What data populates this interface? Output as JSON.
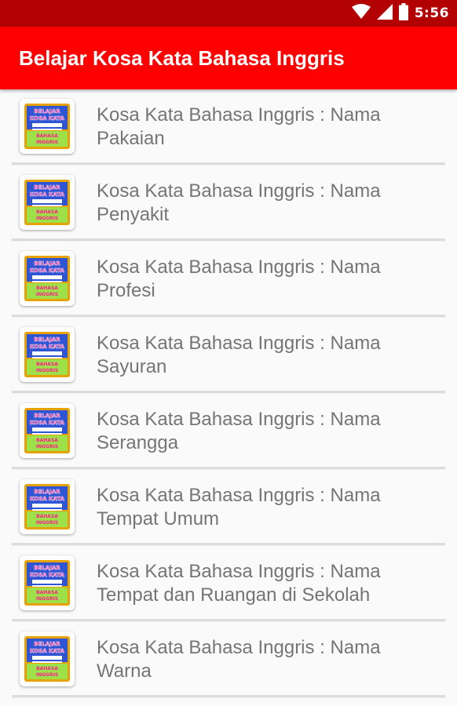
{
  "status_bar": {
    "time": "5:56",
    "icons": [
      "wifi-icon",
      "signal-icon",
      "battery-icon"
    ],
    "color": "#b30000"
  },
  "app_bar": {
    "title": "Belajar Kosa Kata Bahasa Inggris",
    "color": "#ff0000"
  },
  "app_icon": {
    "line1": "BELAJAR",
    "line2": "KOSA KATA",
    "line3": "BAHASA",
    "line4": "INGGRIS"
  },
  "list": {
    "items": [
      {
        "line1": "Kosa Kata Bahasa Inggris : Nama",
        "line2": "Pakaian"
      },
      {
        "line1": "Kosa Kata Bahasa Inggris : Nama",
        "line2": "Penyakit"
      },
      {
        "line1": "Kosa Kata Bahasa Inggris : Nama",
        "line2": "Profesi"
      },
      {
        "line1": "Kosa Kata Bahasa Inggris : Nama",
        "line2": "Sayuran"
      },
      {
        "line1": "Kosa Kata Bahasa Inggris : Nama",
        "line2": "Serangga"
      },
      {
        "line1": "Kosa Kata Bahasa Inggris : Nama",
        "line2": "Tempat Umum"
      },
      {
        "line1": "Kosa Kata Bahasa Inggris : Nama",
        "line2": "Tempat dan Ruangan di Sekolah"
      },
      {
        "line1": "Kosa Kata Bahasa Inggris : Nama",
        "line2": "Warna"
      }
    ]
  }
}
